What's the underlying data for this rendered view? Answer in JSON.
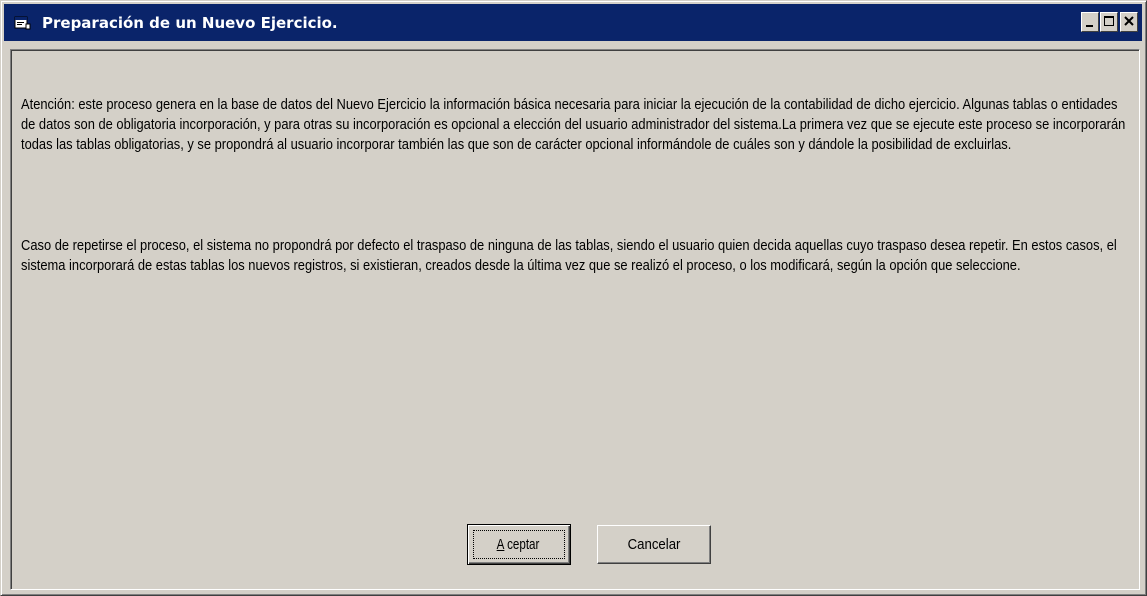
{
  "window": {
    "title": "Preparación de un Nuevo Ejercicio.",
    "icon": "form-window-icon",
    "controls": {
      "minimize_icon": "minimize-icon",
      "maximize_icon": "maximize-icon",
      "close_icon": "close-icon"
    },
    "colors": {
      "titlebar": "#0a246a",
      "face": "#d4d0c8",
      "title_text": "#ffffff"
    }
  },
  "content": {
    "paragraph_1": " Atención: este proceso genera en la base de datos del Nuevo Ejercicio la información básica necesaria para iniciar la ejecución de la contabilidad de dicho ejercicio. Algunas tablas o entidades de datos son de obligatoria incorporación, y para otras su incorporación es opcional a elección del usuario administrador del sistema.La primera vez que se ejecute este proceso se incorporarán todas las tablas obligatorias, y se propondrá al usuario incorporar también las que son de carácter opcional informándole de cuáles son y dándole la posibilidad de excluirlas.",
    "paragraph_2": " Caso de repetirse el proceso, el sistema no propondrá por defecto el traspaso de ninguna de las tablas, siendo el usuario quien decida aquellas cuyo traspaso desea repetir. En estos casos, el sistema incorporará de estas tablas los nuevos registros, si existieran, creados desde la última vez que se realizó el proceso, o los modificará, según la opción que seleccione."
  },
  "buttons": {
    "accept_label_first": "A",
    "accept_label_rest": "ceptar",
    "cancel_label": "Cancelar"
  }
}
